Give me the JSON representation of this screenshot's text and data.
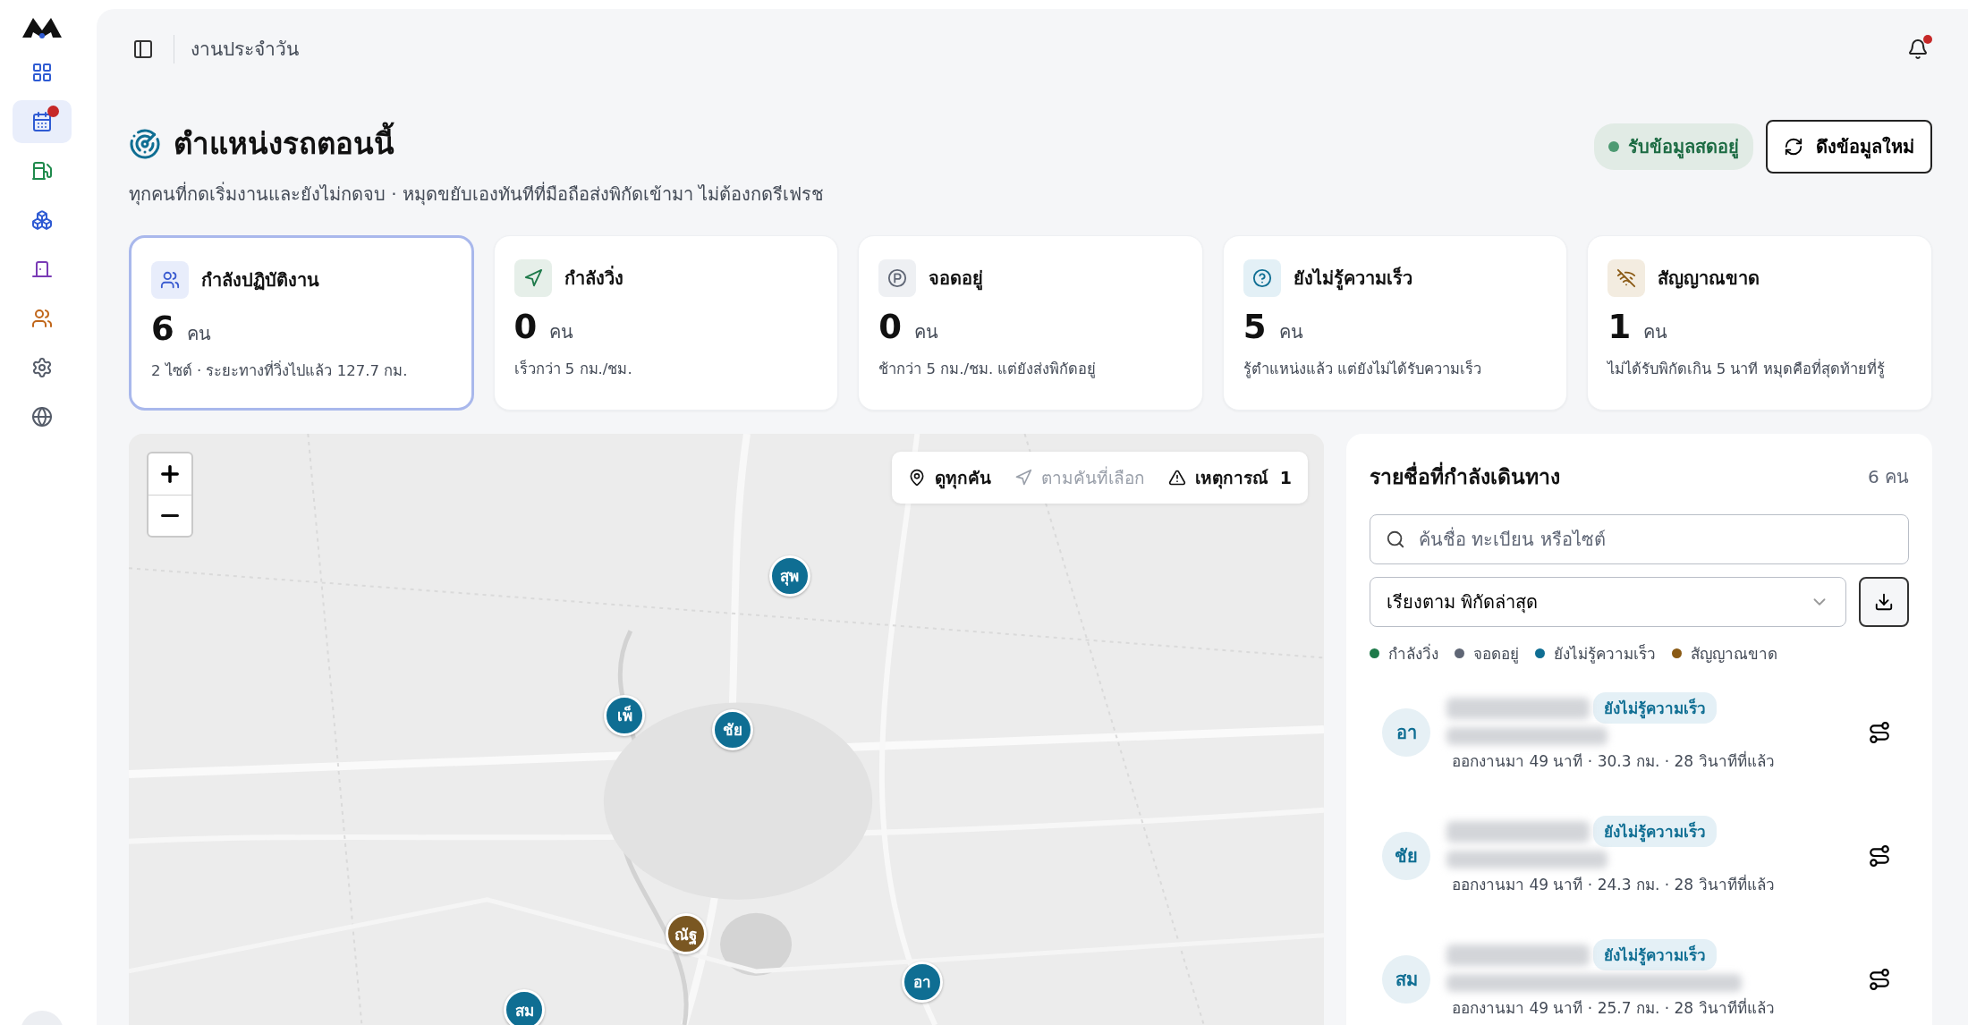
{
  "sidebar": {
    "items": [
      {
        "kind": "dashboard",
        "selected": false,
        "badge": false
      },
      {
        "kind": "calendar",
        "selected": true,
        "badge": true
      },
      {
        "kind": "fuel",
        "selected": false,
        "badge": false
      },
      {
        "kind": "boxes",
        "selected": false,
        "badge": false
      },
      {
        "kind": "door",
        "selected": false,
        "badge": false
      },
      {
        "kind": "users",
        "selected": false,
        "badge": false
      },
      {
        "kind": "settings",
        "selected": false,
        "badge": false
      },
      {
        "kind": "globe",
        "selected": false,
        "badge": false
      }
    ]
  },
  "header": {
    "breadcrumb": "งานประจำวัน",
    "notification_badge": true
  },
  "page": {
    "title": "ตำแหน่งรถตอนนี้",
    "subtitle": "ทุกคนที่กดเริ่มงานและยังไม่กดจบ · หมุดขยับเองทันทีที่มือถือส่งพิกัดเข้ามา ไม่ต้องกดรีเฟรช",
    "live_badge": "รับข้อมูลสดอยู่",
    "refresh_button": "ดึงข้อมูลใหม่"
  },
  "stats": [
    {
      "kind": "active",
      "label": "กำลังปฏิบัติงาน",
      "value": "6",
      "unit": "คน",
      "note": "2 ไซต์ · ระยะทางที่วิ่งไปแล้ว 127.7 กม.",
      "selected": true
    },
    {
      "kind": "moving",
      "label": "กำลังวิ่ง",
      "value": "0",
      "unit": "คน",
      "note": "เร็วกว่า 5 กม./ชม.",
      "selected": false
    },
    {
      "kind": "parked",
      "label": "จอดอยู่",
      "value": "0",
      "unit": "คน",
      "note": "ช้ากว่า 5 กม./ชม. แต่ยังส่งพิกัดอยู่",
      "selected": false
    },
    {
      "kind": "unknown",
      "label": "ยังไม่รู้ความเร็ว",
      "value": "5",
      "unit": "คน",
      "note": "รู้ตำแหน่งแล้ว แต่ยังไม่ได้รับความเร็ว",
      "selected": false
    },
    {
      "kind": "lost",
      "label": "สัญญาณขาด",
      "value": "1",
      "unit": "คน",
      "note": "ไม่ได้รับพิกัดเกิน 5 นาที หมุดคือที่สุดท้ายที่รู้",
      "selected": false
    }
  ],
  "map": {
    "controls": [
      {
        "kind": "all",
        "label": "ดูทุกคัน",
        "disabled": false
      },
      {
        "kind": "follow",
        "label": "ตามคันที่เลือก",
        "disabled": true
      },
      {
        "kind": "incident",
        "label": "เหตุการณ์  1",
        "disabled": false
      }
    ],
    "markers": [
      {
        "label": "สุพ",
        "color": "#0f6e93"
      },
      {
        "label": "เพ็",
        "color": "#0f6e93"
      },
      {
        "label": "ชัย",
        "color": "#0f6e93"
      },
      {
        "label": "ณัฐ",
        "color": "#7a5722"
      },
      {
        "label": "อา",
        "color": "#0f6e93"
      },
      {
        "label": "สม",
        "color": "#0f6e93"
      }
    ]
  },
  "panel": {
    "title": "รายชื่อที่กำลังเดินทาง",
    "count": "6 คน",
    "search": {
      "placeholder": "ค้นชื่อ ทะเบียน หรือไซต์"
    },
    "sort": "เรียงตาม พิกัดล่าสุด",
    "legend": [
      {
        "label": "กำลังวิ่ง",
        "color": "#1e7a4a"
      },
      {
        "label": "จอดอยู่",
        "color": "#5f6675"
      },
      {
        "label": "ยังไม่รู้ความเร็ว",
        "color": "#0f6e93"
      },
      {
        "label": "สัญญาณขาด",
        "color": "#8a5a14"
      }
    ],
    "drivers": [
      {
        "initials": "อา",
        "status": "ยังไม่รู้ความเร็ว",
        "meta": "ออกงานมา 49 นาที · 30.3 กม. · 28 วินาทีที่แล้ว"
      },
      {
        "initials": "ชัย",
        "status": "ยังไม่รู้ความเร็ว",
        "meta": "ออกงานมา 49 นาที · 24.3 กม. · 28 วินาทีที่แล้ว"
      },
      {
        "initials": "สม",
        "status": "ยังไม่รู้ความเร็ว",
        "meta": "ออกงานมา 49 นาที · 25.7 กม. · 28 วินาทีที่แล้ว"
      }
    ]
  }
}
